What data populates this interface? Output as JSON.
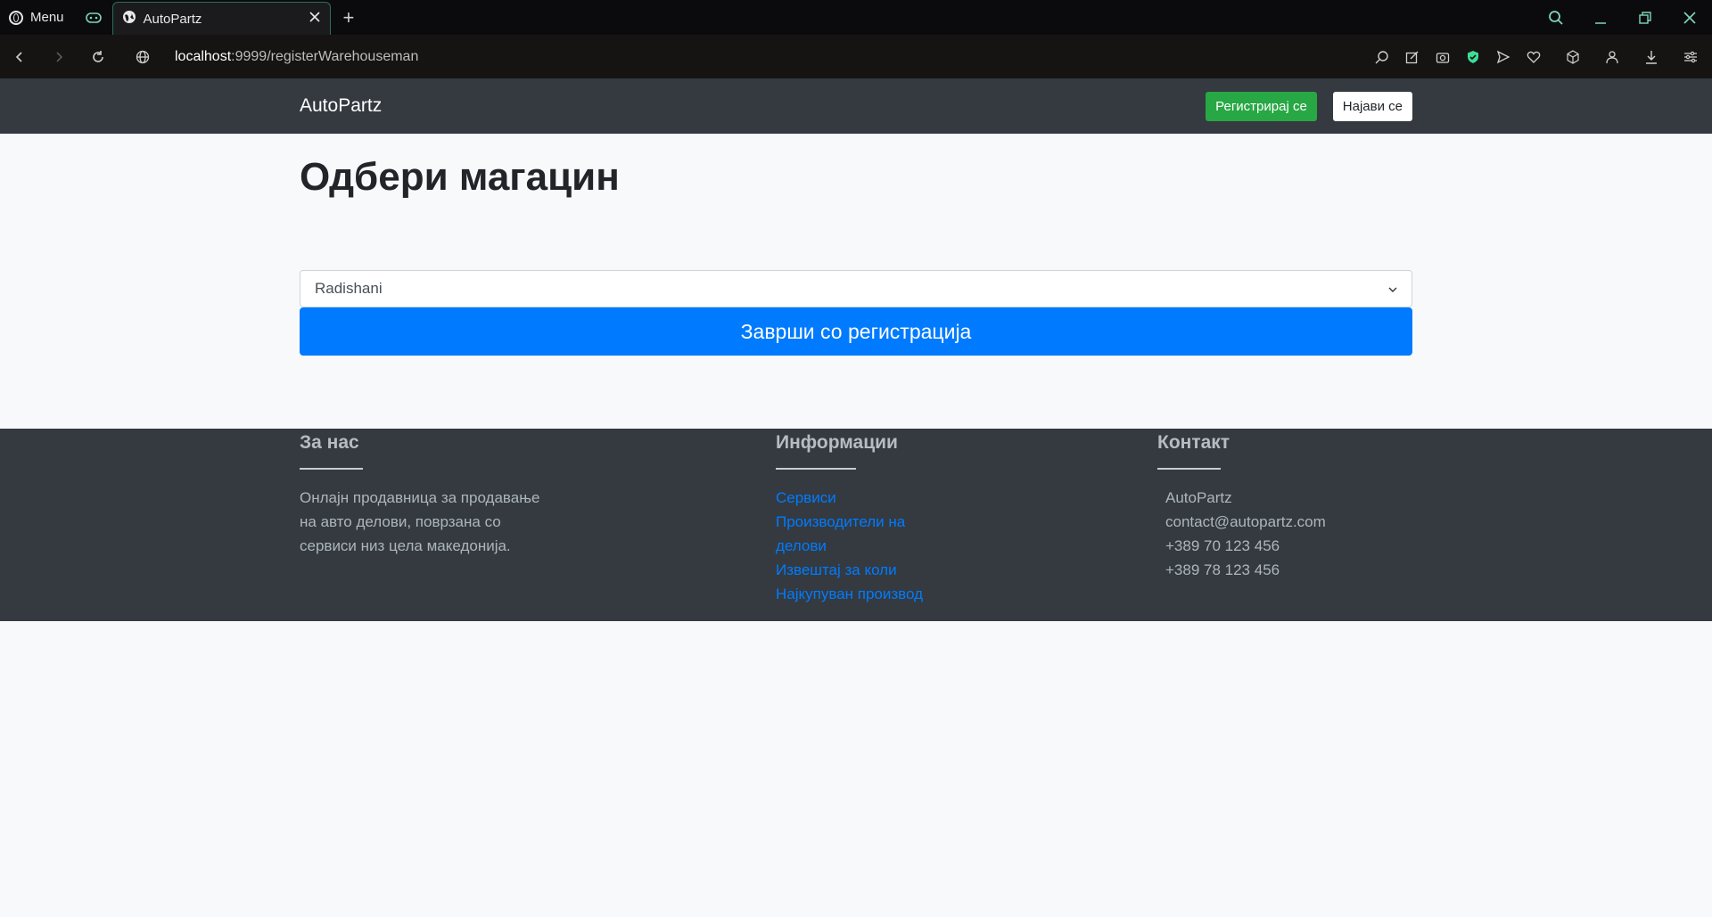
{
  "browser": {
    "menu_label": "Menu",
    "tab_title": "AutoPartz",
    "url_host": "localhost",
    "url_path": ":9999/registerWarehouseman"
  },
  "navbar": {
    "brand": "AutoPartz",
    "register_label": "Регистрирај се",
    "login_label": "Најави се"
  },
  "main": {
    "title": "Одбери магацин",
    "select_value": "Radishani",
    "finish_button": "Заврши со регистрација"
  },
  "footer": {
    "about": {
      "heading": "За нас",
      "lines": [
        "Онлајн продавница за продавање",
        "на авто делови, поврзана со",
        "сервиси низ цела македонија."
      ]
    },
    "info": {
      "heading": "Информации",
      "links": [
        "Сервиси",
        "Производители на",
        "делови",
        "Извештај за коли",
        "Најкупуван производ"
      ]
    },
    "contact": {
      "heading": "Контакт",
      "lines": [
        "AutoPartz",
        "contact@autopartz.com",
        "+389 70 123 456",
        "+389 78 123 456"
      ]
    }
  },
  "colors": {
    "navbar_bg": "#343a40",
    "primary": "#007bff",
    "success": "#28a745"
  }
}
